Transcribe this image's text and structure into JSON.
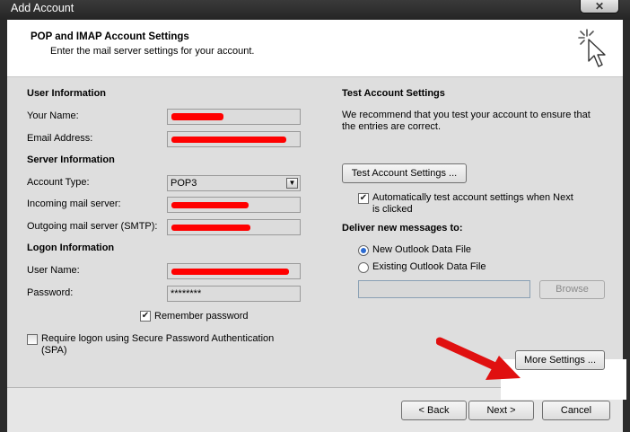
{
  "window": {
    "title": "Add Account",
    "close_glyph": "✕"
  },
  "header": {
    "title": "POP and IMAP Account Settings",
    "subtitle": "Enter the mail server settings for your account.",
    "icon": "cursor-sparkle-icon"
  },
  "user_info": {
    "heading": "User Information",
    "your_name_label": "Your Name:",
    "email_label": "Email Address:"
  },
  "server_info": {
    "heading": "Server Information",
    "account_type_label": "Account Type:",
    "account_type_value": "POP3",
    "incoming_label": "Incoming mail server:",
    "outgoing_label": "Outgoing mail server (SMTP):"
  },
  "logon_info": {
    "heading": "Logon Information",
    "user_name_label": "User Name:",
    "password_label": "Password:",
    "password_value": "********",
    "remember_password_label": "Remember password",
    "remember_password_checked": true,
    "spa_label_line1": "Require logon using Secure Password Authentication",
    "spa_label_line2": "(SPA)",
    "spa_checked": false
  },
  "test_settings": {
    "heading": "Test Account Settings",
    "desc_line1": "We recommend that you test your account to ensure that",
    "desc_line2": "the entries are correct.",
    "test_button": "Test Account Settings ...",
    "auto_test_line1": "Automatically test account settings when Next",
    "auto_test_line2": "is clicked",
    "auto_test_checked": true
  },
  "deliver": {
    "heading": "Deliver new messages to:",
    "new_file_label": "New Outlook Data File",
    "existing_file_label": "Existing Outlook Data File",
    "selected": "new",
    "browse_button": "Browse"
  },
  "more_settings_button": "More Settings ...",
  "footer": {
    "back_button": "< Back",
    "next_button": "Next >",
    "cancel_button": "Cancel"
  },
  "colors": {
    "redaction": "#ff0000",
    "annotation_arrow": "#e01010"
  }
}
